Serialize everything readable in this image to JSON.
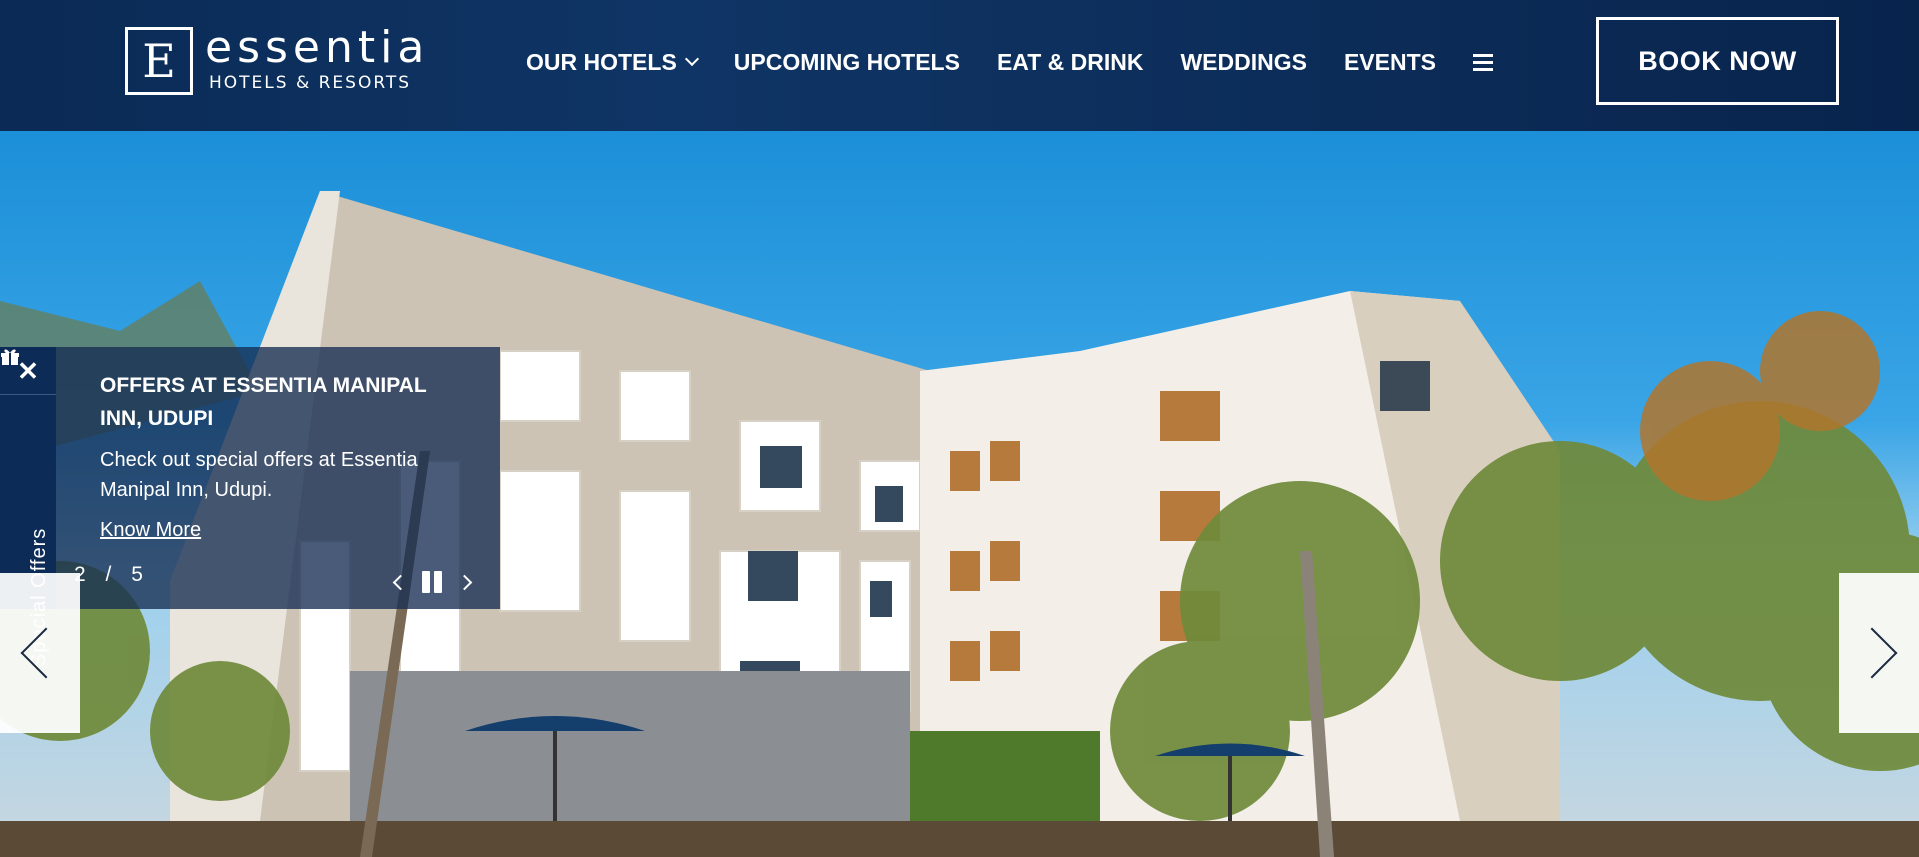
{
  "header": {
    "logo": {
      "mark": "E",
      "word": "essentia",
      "sub": "HOTELS & RESORTS"
    },
    "nav": [
      {
        "label": "OUR HOTELS",
        "has_dropdown": true
      },
      {
        "label": "UPCOMING HOTELS"
      },
      {
        "label": "EAT & DRINK"
      },
      {
        "label": "WEDDINGS"
      },
      {
        "label": "EVENTS"
      }
    ],
    "menu_icon": "hamburger-icon",
    "book_label": "BOOK NOW"
  },
  "side_tab": {
    "close_icon": "close-icon",
    "gift_icon": "gift-icon",
    "label": "Special Offers"
  },
  "offer": {
    "title": "OFFERS AT ESSENTIA MANIPAL INN, UDUPI",
    "description": "Check out special offers at Essentia Manipal Inn, Udupi.",
    "link_label": "Know More",
    "current": "2",
    "separator": "/",
    "total": "5"
  },
  "colors": {
    "header_bg": "#0c2c58",
    "panel_bg": "#162d52",
    "accent_text": "#ffffff"
  }
}
